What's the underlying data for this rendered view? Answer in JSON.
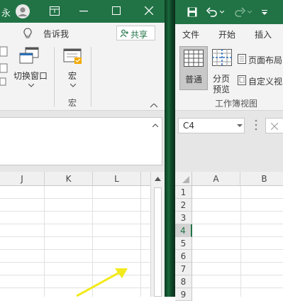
{
  "left_window": {
    "title_fragment": "永",
    "tell_me": "告诉我",
    "share_label": "共享",
    "switch_window_label": "切换窗口",
    "macro_label": "宏",
    "macro_group_label": "宏",
    "columns": [
      "J",
      "K",
      "L"
    ]
  },
  "right_window": {
    "tabs": [
      "文件",
      "开始",
      "插入"
    ],
    "normal_label": "普通",
    "page_break_label_1": "分页",
    "page_break_label_2": "预览",
    "page_layout_label": "页面布局",
    "custom_view_label": "自定义视",
    "workbook_views_group": "工作簿视图",
    "name_box_value": "C4",
    "columns": [
      "A",
      "B"
    ],
    "rows": [
      "1",
      "2",
      "3",
      "4",
      "5",
      "6",
      "7",
      "8",
      "9"
    ]
  },
  "colors": {
    "excel_green": "#217346",
    "ribbon_bg": "#f3f3f3",
    "arrow_yellow": "#f2ea1c"
  }
}
